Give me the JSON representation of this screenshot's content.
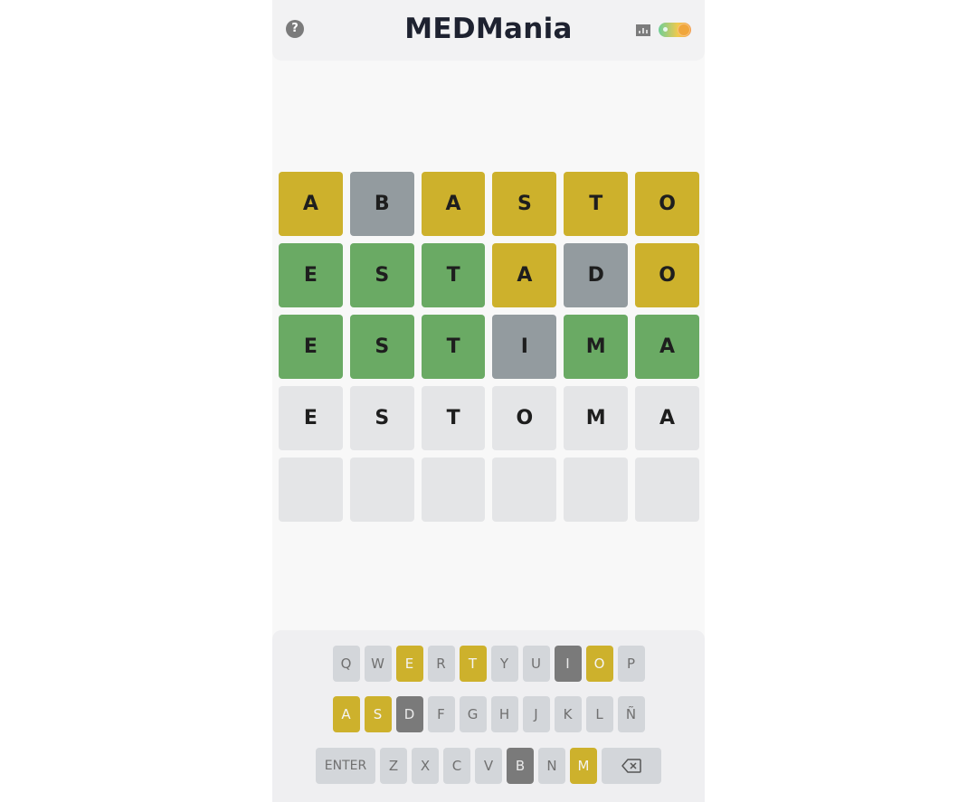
{
  "header": {
    "title": "MEDMania",
    "help_icon": "question-circle-icon",
    "stats_icon": "bar-chart-icon",
    "theme_toggle_icon": "theme-toggle-icon"
  },
  "colors": {
    "correct": "#6aaa64",
    "present": "#cdb12c",
    "absent": "#939b9f",
    "empty": "#e4e5e7"
  },
  "board": {
    "rows": [
      [
        {
          "l": "A",
          "s": "present"
        },
        {
          "l": "B",
          "s": "absent"
        },
        {
          "l": "A",
          "s": "present"
        },
        {
          "l": "S",
          "s": "present"
        },
        {
          "l": "T",
          "s": "present"
        },
        {
          "l": "O",
          "s": "present"
        }
      ],
      [
        {
          "l": "E",
          "s": "correct"
        },
        {
          "l": "S",
          "s": "correct"
        },
        {
          "l": "T",
          "s": "correct"
        },
        {
          "l": "A",
          "s": "present"
        },
        {
          "l": "D",
          "s": "absent"
        },
        {
          "l": "O",
          "s": "present"
        }
      ],
      [
        {
          "l": "E",
          "s": "correct"
        },
        {
          "l": "S",
          "s": "correct"
        },
        {
          "l": "T",
          "s": "correct"
        },
        {
          "l": "I",
          "s": "absent"
        },
        {
          "l": "M",
          "s": "correct"
        },
        {
          "l": "A",
          "s": "correct"
        }
      ],
      [
        {
          "l": "E",
          "s": "empty"
        },
        {
          "l": "S",
          "s": "empty"
        },
        {
          "l": "T",
          "s": "empty"
        },
        {
          "l": "O",
          "s": "empty"
        },
        {
          "l": "M",
          "s": "empty"
        },
        {
          "l": "A",
          "s": "empty"
        }
      ],
      [
        {
          "l": "",
          "s": "empty"
        },
        {
          "l": "",
          "s": "empty"
        },
        {
          "l": "",
          "s": "empty"
        },
        {
          "l": "",
          "s": "empty"
        },
        {
          "l": "",
          "s": "empty"
        },
        {
          "l": "",
          "s": "empty"
        }
      ]
    ]
  },
  "keyboard": {
    "rows": [
      [
        {
          "k": "Q",
          "s": ""
        },
        {
          "k": "W",
          "s": ""
        },
        {
          "k": "E",
          "s": "present"
        },
        {
          "k": "R",
          "s": ""
        },
        {
          "k": "T",
          "s": "present"
        },
        {
          "k": "Y",
          "s": ""
        },
        {
          "k": "U",
          "s": ""
        },
        {
          "k": "I",
          "s": "absent"
        },
        {
          "k": "O",
          "s": "present"
        },
        {
          "k": "P",
          "s": ""
        }
      ],
      [
        {
          "k": "A",
          "s": "present"
        },
        {
          "k": "S",
          "s": "present"
        },
        {
          "k": "D",
          "s": "absent"
        },
        {
          "k": "F",
          "s": ""
        },
        {
          "k": "G",
          "s": ""
        },
        {
          "k": "H",
          "s": ""
        },
        {
          "k": "J",
          "s": ""
        },
        {
          "k": "K",
          "s": ""
        },
        {
          "k": "L",
          "s": ""
        },
        {
          "k": "Ñ",
          "s": ""
        }
      ],
      [
        {
          "k": "ENTER",
          "s": "",
          "wide": true
        },
        {
          "k": "Z",
          "s": ""
        },
        {
          "k": "X",
          "s": ""
        },
        {
          "k": "C",
          "s": ""
        },
        {
          "k": "V",
          "s": ""
        },
        {
          "k": "B",
          "s": "absent"
        },
        {
          "k": "N",
          "s": ""
        },
        {
          "k": "M",
          "s": "present"
        },
        {
          "k": "",
          "s": "",
          "wide": true,
          "icon": "backspace-icon"
        }
      ]
    ]
  }
}
